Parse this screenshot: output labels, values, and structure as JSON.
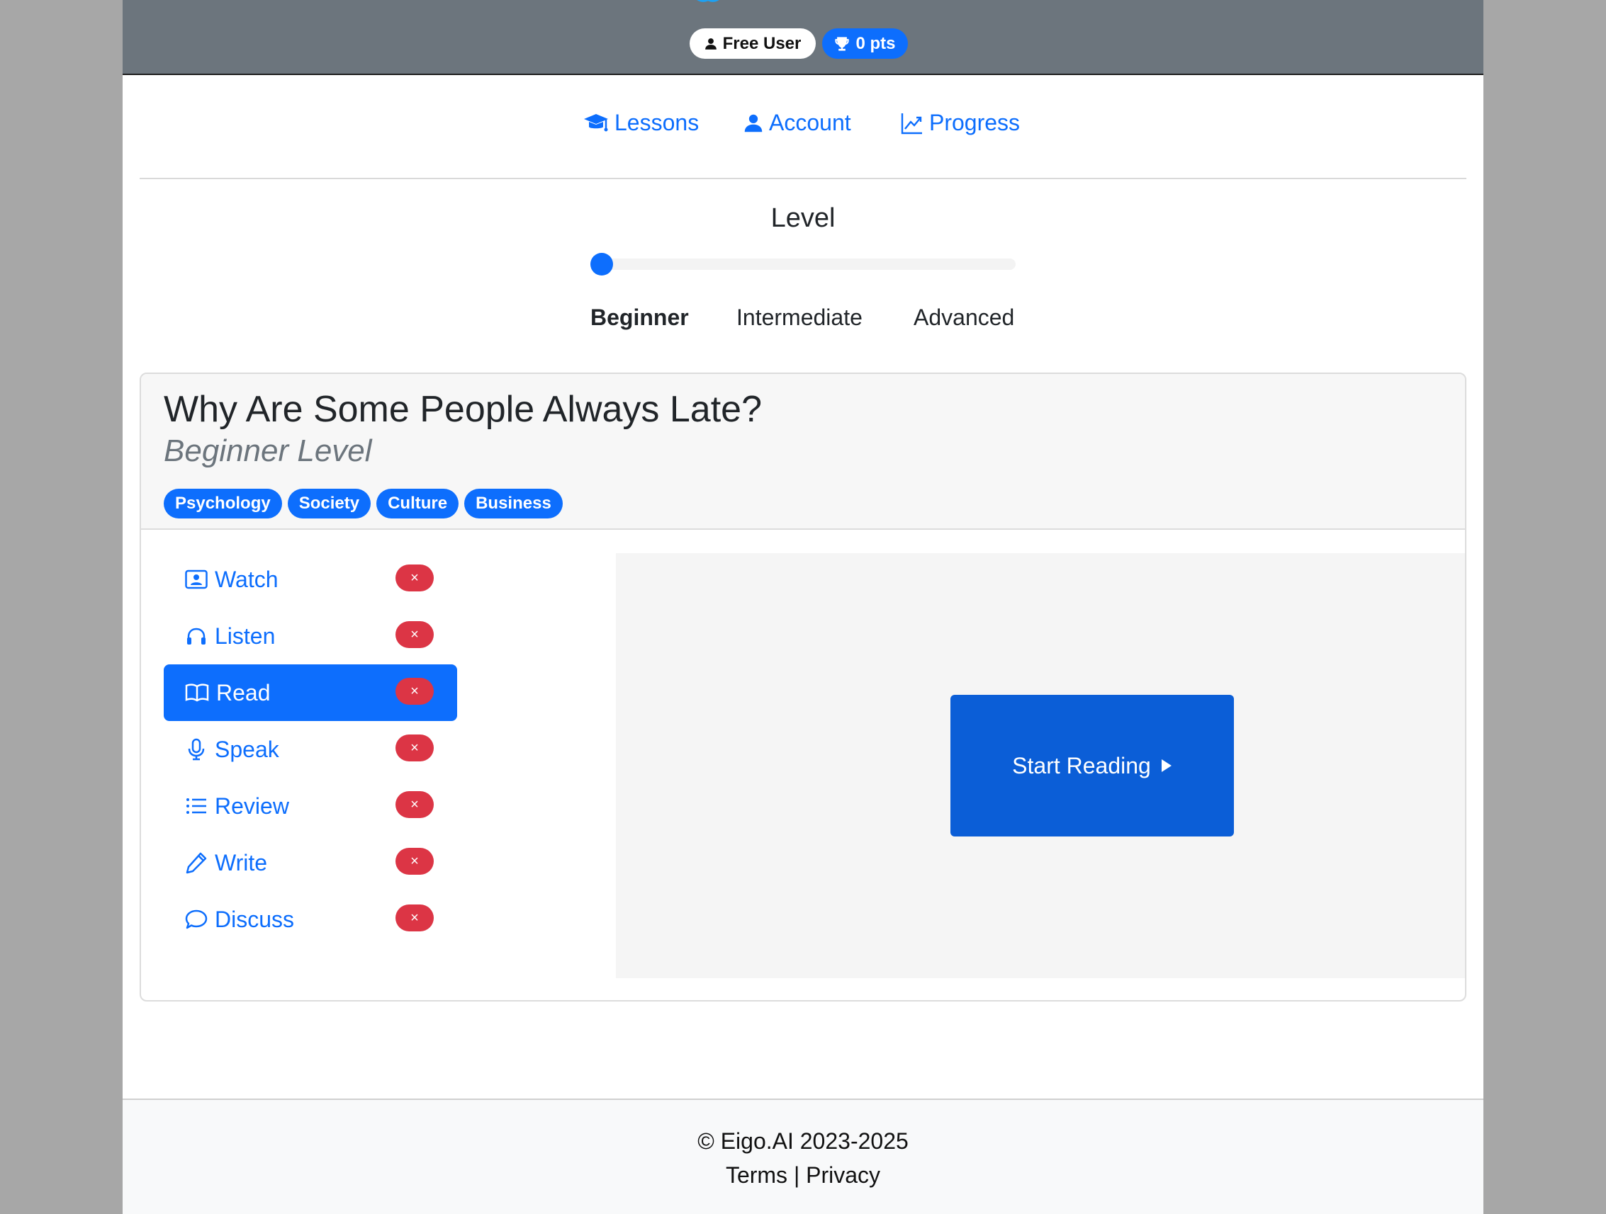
{
  "header": {
    "user_label": "Free User",
    "points_label": "0 pts"
  },
  "nav": {
    "lessons": "Lessons",
    "account": "Account",
    "progress": "Progress"
  },
  "level": {
    "title": "Level",
    "value": 0,
    "options": [
      "Beginner",
      "Intermediate",
      "Advanced"
    ],
    "selected": "Beginner"
  },
  "lesson": {
    "title": "Why Are Some People Always Late?",
    "subtitle": "Beginner Level",
    "tags": [
      "Psychology",
      "Society",
      "Culture",
      "Business"
    ]
  },
  "sidebar": {
    "items": [
      {
        "label": "Watch",
        "icon": "person-video-icon",
        "status": "×"
      },
      {
        "label": "Listen",
        "icon": "headphones-icon",
        "status": "×"
      },
      {
        "label": "Read",
        "icon": "book-icon",
        "status": "×"
      },
      {
        "label": "Speak",
        "icon": "microphone-icon",
        "status": "×"
      },
      {
        "label": "Review",
        "icon": "list-icon",
        "status": "×"
      },
      {
        "label": "Write",
        "icon": "pencil-icon",
        "status": "×"
      },
      {
        "label": "Discuss",
        "icon": "chat-icon",
        "status": "×"
      }
    ],
    "active": "Read"
  },
  "content": {
    "start_label": "Start Reading"
  },
  "footer": {
    "copyright": "© Eigo.AI 2023-2025",
    "terms": "Terms",
    "separator": "|",
    "privacy": "Privacy"
  },
  "colors": {
    "primary": "#0d6efd",
    "danger": "#dc3545",
    "header_bg": "#6c757d"
  }
}
